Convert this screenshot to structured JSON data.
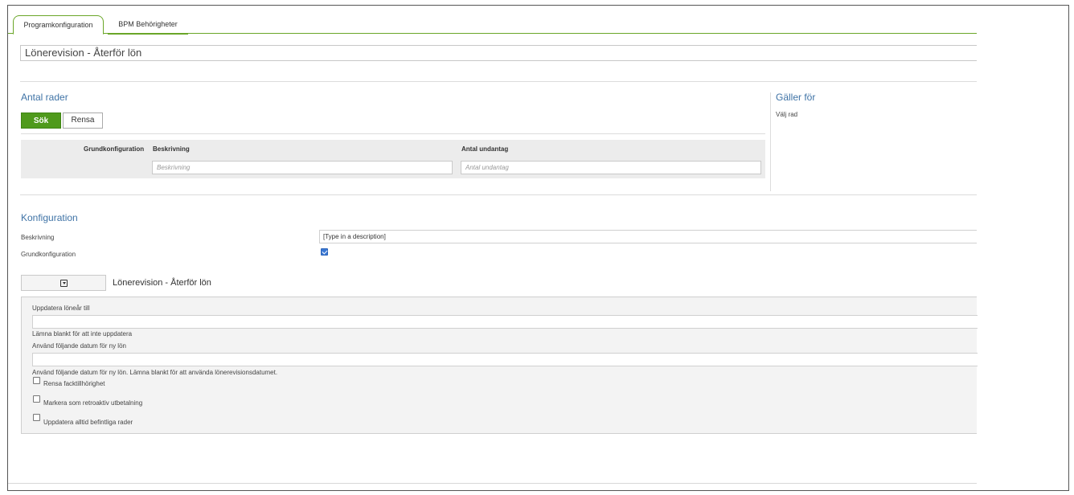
{
  "tabs": [
    {
      "label": "Programkonfiguration",
      "active": true
    },
    {
      "label": "BPM Behörigheter",
      "active": false
    }
  ],
  "page_title": "Lönerevision - Återför lön",
  "antal_rader": {
    "title": "Antal rader",
    "search_label": "Sök",
    "clear_label": "Rensa",
    "columns": [
      "Grundkonfiguration",
      "Beskrivning",
      "Antal undantag"
    ],
    "filters": {
      "beskrivning_placeholder": "Beskrivning",
      "antal_undantag_placeholder": "Antal undantag"
    }
  },
  "galler_for": {
    "title": "Gäller för",
    "subtitle": "Välj rad"
  },
  "konfiguration": {
    "title": "Konfiguration",
    "beskrivning_label": "Beskrivning",
    "beskrivning_value": "[Type in a description]",
    "grundkonfiguration_label": "Grundkonfiguration",
    "grundkonfiguration_checked": true
  },
  "section": {
    "title": "Lönerevision - Återför lön",
    "fields": {
      "uppdatera_label": "Uppdatera löneår till",
      "uppdatera_hint": "Lämna blankt för att inte uppdatera",
      "datum_label": "Använd följande datum för ny lön",
      "datum_hint": "Använd följande datum för ny lön. Lämna blankt för att använda lönerevisionsdatumet."
    },
    "checkboxes": [
      {
        "label": "Rensa facktillhörighet",
        "checked": false
      },
      {
        "label": "Markera som retroaktiv utbetalning",
        "checked": false
      },
      {
        "label": "Uppdatera alltid befintliga rader",
        "checked": false
      }
    ]
  },
  "colors": {
    "accent_green": "#4f9a1c",
    "section_title_blue": "#3f73a6"
  }
}
